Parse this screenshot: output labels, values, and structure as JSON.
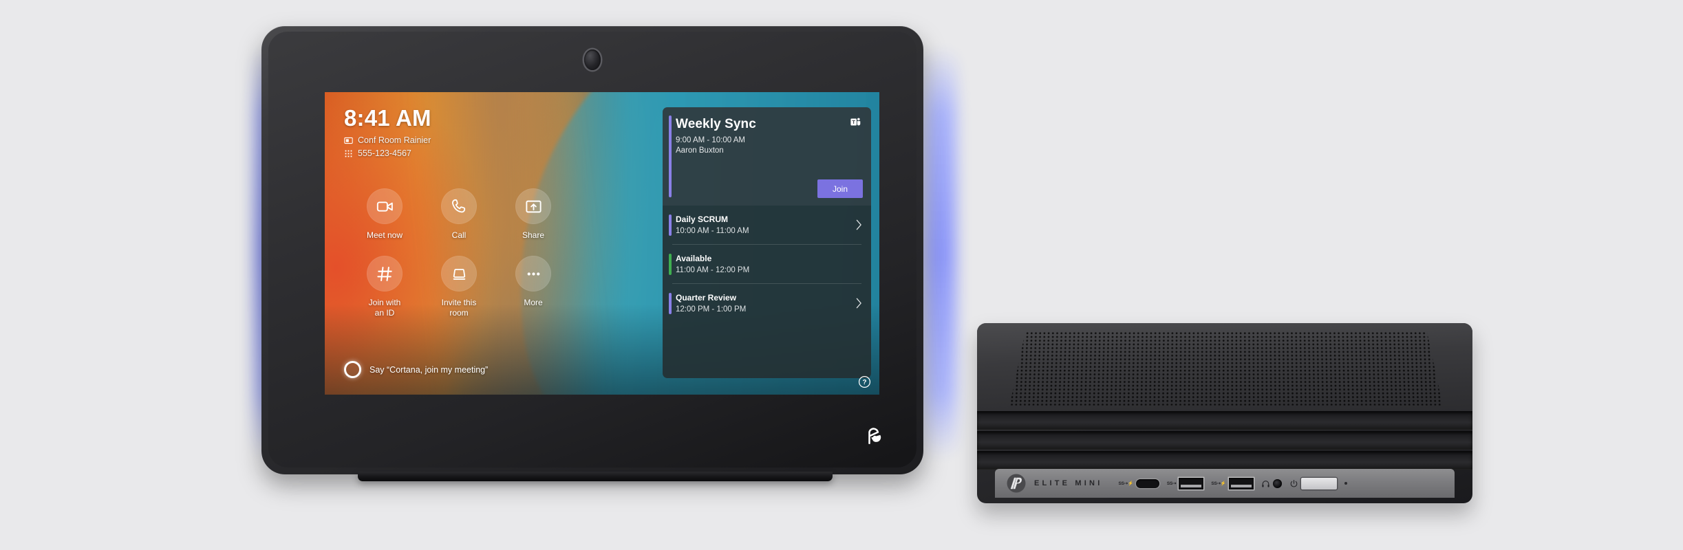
{
  "device_panel": {
    "brand_logo": "poly-logo",
    "camera": "front-camera",
    "screen": {
      "clock": "8:41 AM",
      "room_name": "Conf Room Rainier",
      "room_icon": "display-icon",
      "phone_number": "555-123-4567",
      "phone_icon": "dialpad-icon",
      "actions": [
        {
          "label": "Meet now",
          "icon": "video-camera-icon"
        },
        {
          "label": "Call",
          "icon": "phone-icon"
        },
        {
          "label": "Share",
          "icon": "share-screen-icon"
        },
        {
          "label": "Join with\nan ID",
          "line1": "Join with",
          "line2": "an ID",
          "icon": "hash-icon"
        },
        {
          "label": "Invite this\nroom",
          "line1": "Invite this",
          "line2": "room",
          "icon": "room-device-icon"
        },
        {
          "label": "More",
          "icon": "ellipsis-icon"
        }
      ],
      "cortana": {
        "icon": "cortana-ring-icon",
        "text": "Say “Cortana, join my meeting”"
      },
      "meeting_panel": {
        "current": {
          "title": "Weekly Sync",
          "time": "9:00 AM - 10:00 AM",
          "organizer": "Aaron Buxton",
          "provider_icon": "microsoft-teams-icon",
          "join_label": "Join",
          "accent_color": "#8a80e8"
        },
        "upcoming": [
          {
            "title": "Daily SCRUM",
            "time": "10:00 AM - 11:00 AM",
            "accent_color": "#8a80e8",
            "has_chevron": true
          },
          {
            "title": "Available",
            "time": "11:00 AM - 12:00 PM",
            "accent_color": "#3fae50",
            "has_chevron": false
          },
          {
            "title": "Quarter Review",
            "time": "12:00 PM - 1:00 PM",
            "accent_color": "#8a80e8",
            "has_chevron": true
          }
        ]
      },
      "help_icon": "help-circle-icon"
    }
  },
  "mini_pc": {
    "brand_logo": "hp-logo",
    "model_name": "ELITE MINI",
    "ports": [
      {
        "name": "usb-c-port",
        "mark": "SS⇢⚡"
      },
      {
        "name": "usb-a-port-1",
        "mark": "SS⇢"
      },
      {
        "name": "usb-a-port-2",
        "mark": "SS⇢⚡"
      },
      {
        "name": "headphone-jack",
        "mark": ""
      },
      {
        "name": "power-button",
        "mark": ""
      }
    ]
  },
  "colors": {
    "accent_purple": "#7b72e0",
    "event_purple": "#8a80e8",
    "available_green": "#3fae50",
    "page_bg": "#e9e9eb"
  }
}
